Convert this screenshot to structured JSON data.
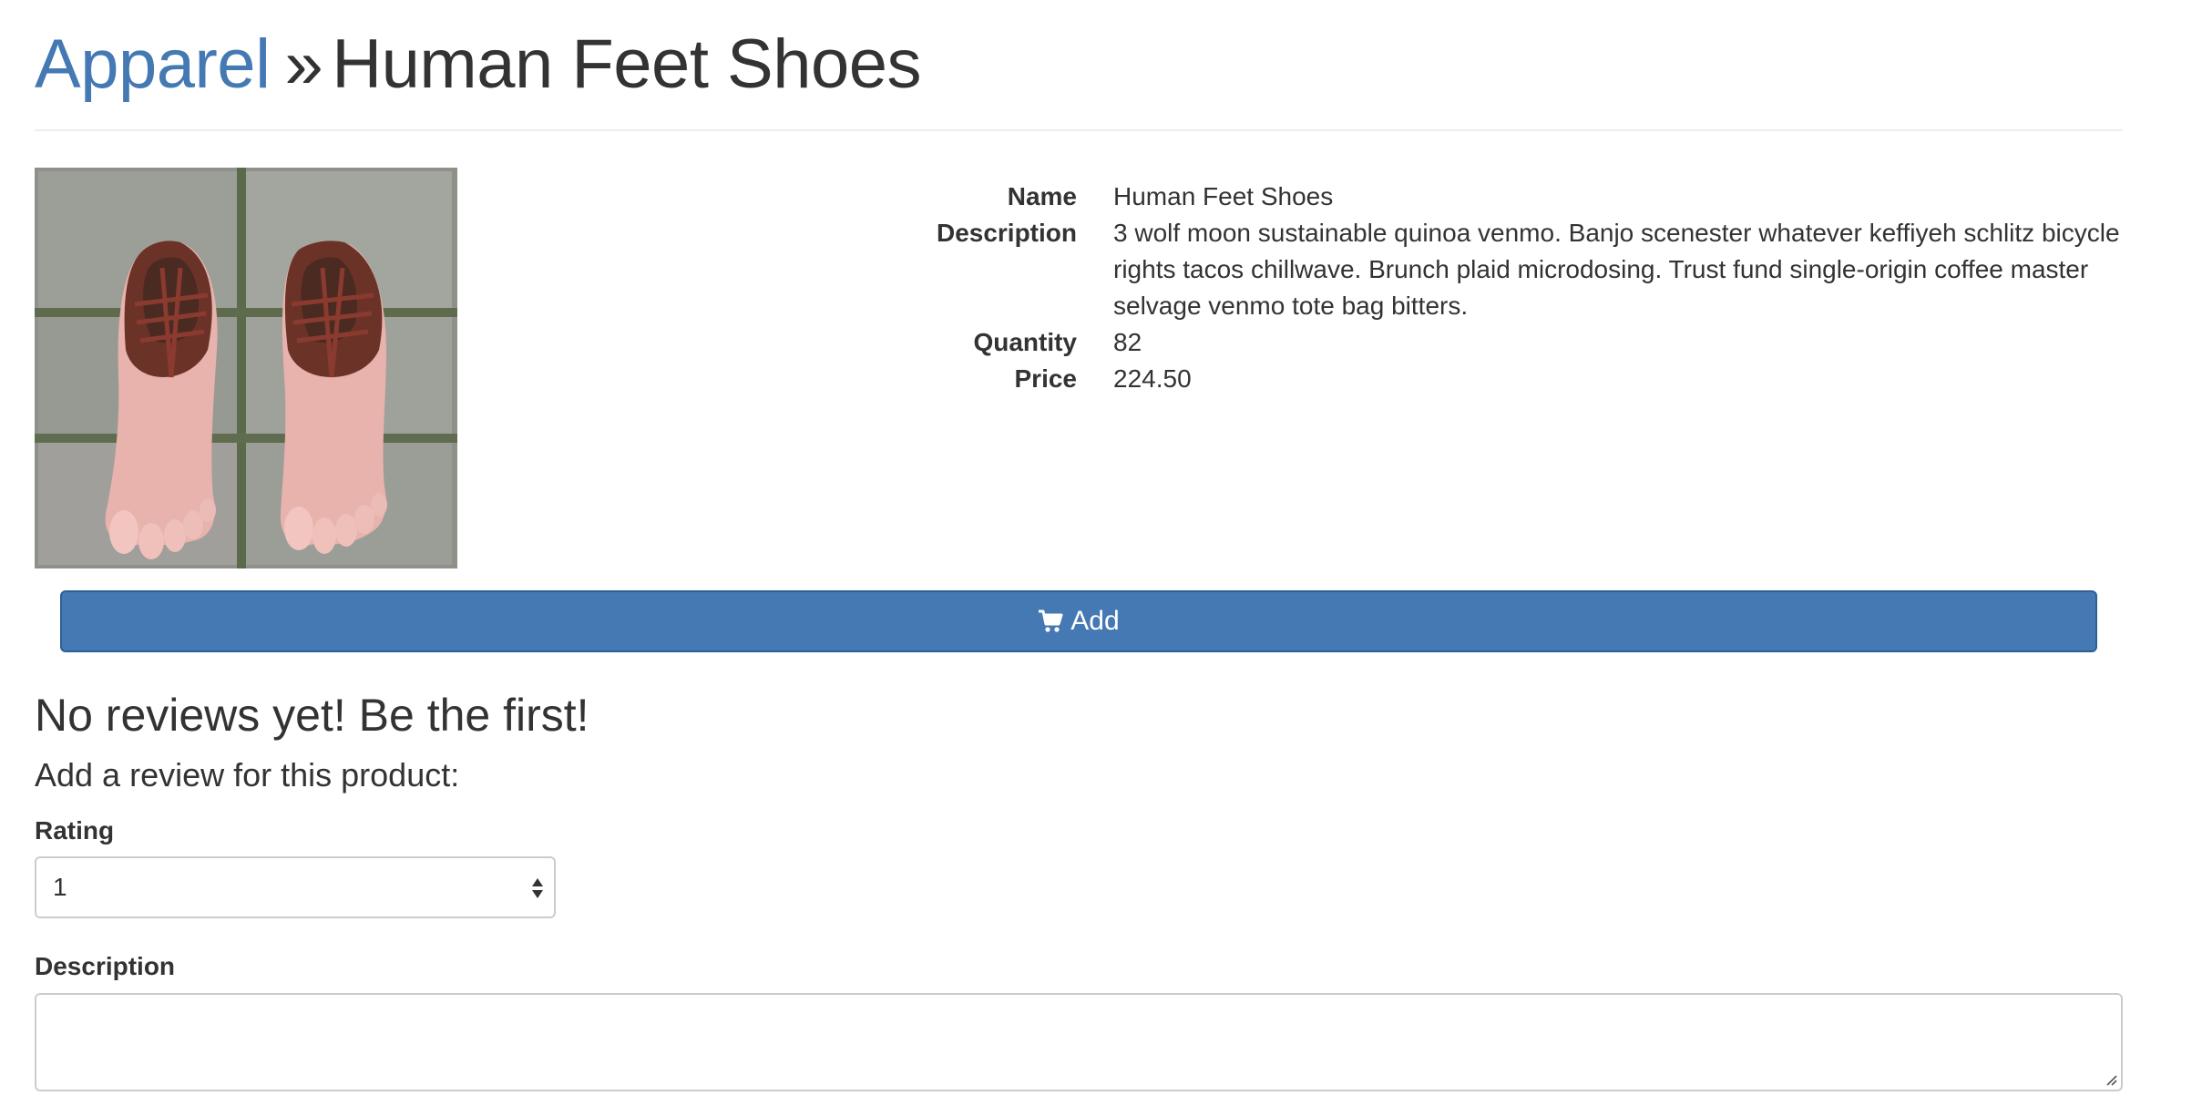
{
  "breadcrumb": {
    "category": "Apparel",
    "separator": "»",
    "current": "Human Feet Shoes"
  },
  "product": {
    "image_alt": "Human Feet Shoes",
    "fields": {
      "name_label": "Name",
      "name_value": "Human Feet Shoes",
      "description_label": "Description",
      "description_value": "3 wolf moon sustainable quinoa venmo. Banjo scenester whatever keffiyeh schlitz bicycle rights tacos chillwave. Brunch plaid microdosing. Trust fund single-origin coffee master selvage venmo tote bag bitters.",
      "quantity_label": "Quantity",
      "quantity_value": "82",
      "price_label": "Price",
      "price_value": "224.50"
    }
  },
  "cart": {
    "add_label": "Add",
    "icon": "shopping-cart-icon"
  },
  "reviews": {
    "empty_heading": "No reviews yet! Be the first!",
    "form_heading": "Add a review for this product:",
    "rating_label": "Rating",
    "rating_value": "1",
    "description_label": "Description",
    "description_value": ""
  },
  "colors": {
    "link": "#4479b3",
    "primary": "#4479b3",
    "text": "#333333"
  }
}
